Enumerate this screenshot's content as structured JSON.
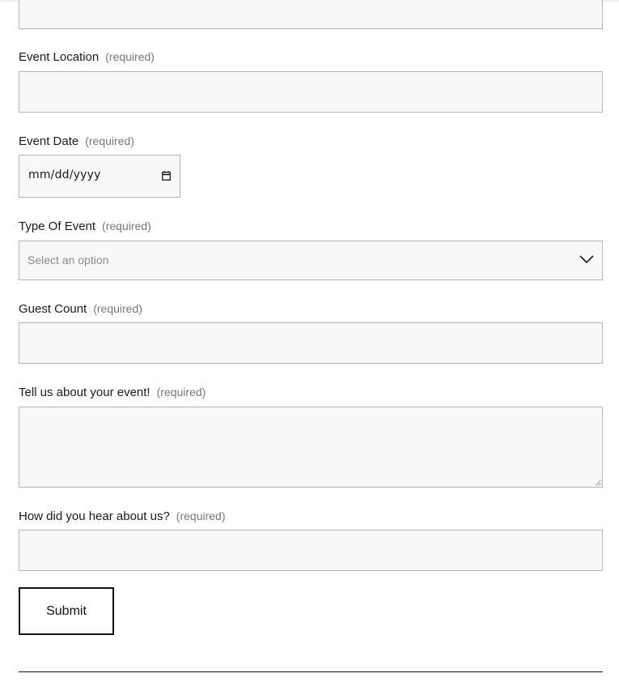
{
  "form": {
    "required_tag": "(required)",
    "fields": {
      "event_location": {
        "label": "Event Location",
        "value": ""
      },
      "event_date": {
        "label": "Event Date",
        "value": "mm/dd/yyyy"
      },
      "event_type": {
        "label": "Type Of Event",
        "value": "Select an option"
      },
      "guest_count": {
        "label": "Guest Count",
        "value": ""
      },
      "event_details": {
        "label": "Tell us about your event!",
        "value": ""
      },
      "referral": {
        "label": "How did you hear about us?",
        "value": ""
      }
    },
    "submit_label": "Submit"
  },
  "icons": {
    "date_picker": "calendar-icon",
    "select_dropdown": "chevron-down-icon",
    "textarea_resize": "resize-handle-icon"
  },
  "colors": {
    "input_background": "#f8f8f8",
    "input_border": "#b3b3b3",
    "text": "#1a1a1a",
    "required_text": "#777777",
    "placeholder_text": "#8a8a8a",
    "button_border": "#111111"
  }
}
